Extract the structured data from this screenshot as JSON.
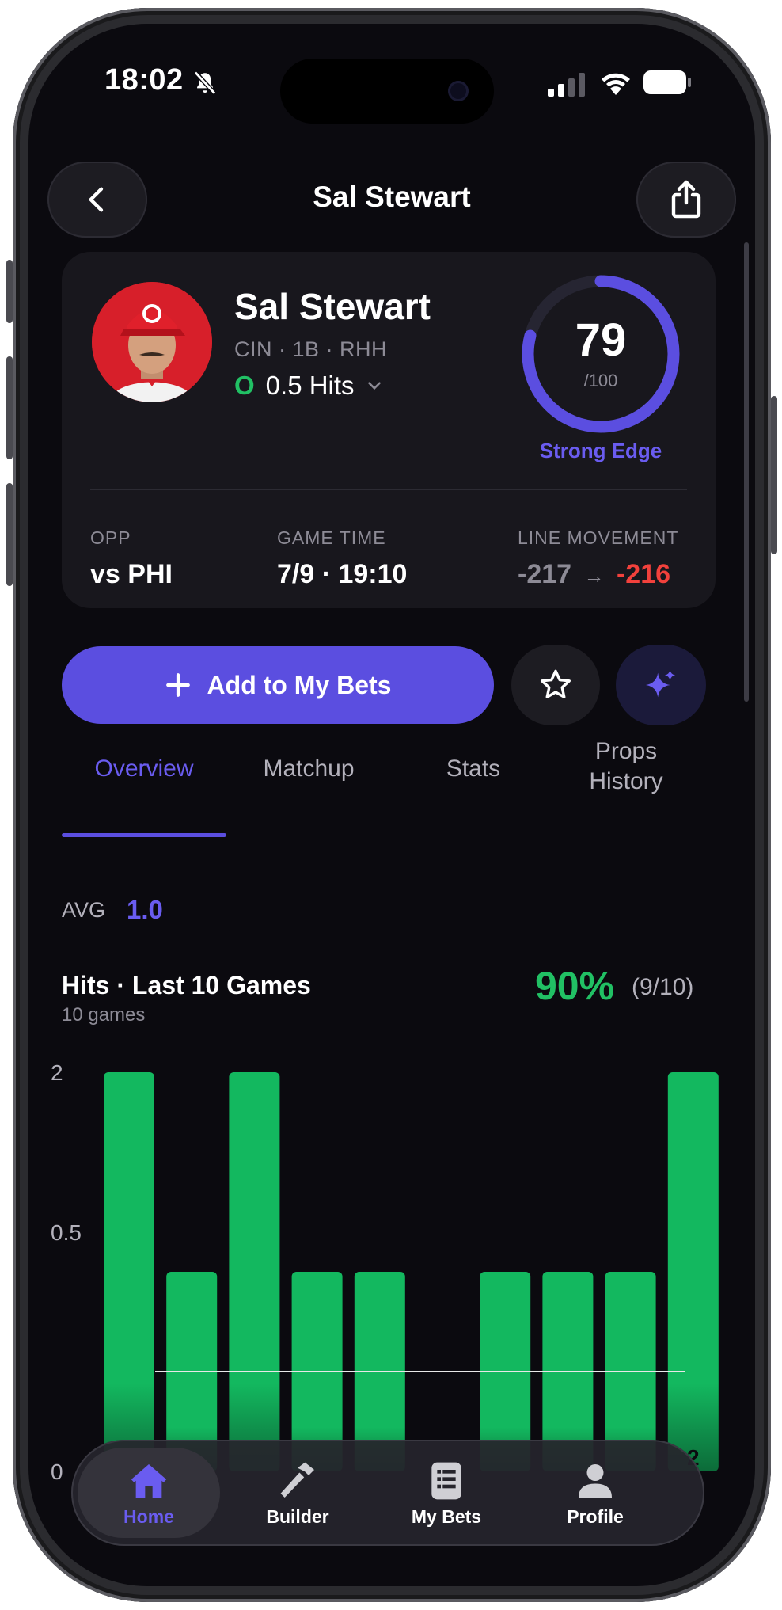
{
  "status": {
    "time": "18:02"
  },
  "nav": {
    "title": "Sal Stewart"
  },
  "player": {
    "name": "Sal Stewart",
    "meta": "CIN · 1B · RHH",
    "side": "O",
    "line": "0.5 Hits",
    "score": "79",
    "score_max": "/100",
    "score_fraction": 0.79,
    "edge_label": "Strong Edge"
  },
  "info": {
    "opp_label": "OPP",
    "opp_value": "vs PHI",
    "time_label": "GAME TIME",
    "time_value": "7/9 · 19:10",
    "move_label": "LINE MOVEMENT",
    "move_from": "-217",
    "move_arrow": "→",
    "move_to": "-216"
  },
  "actions": {
    "add_label": "Add to My Bets"
  },
  "tabs": [
    {
      "label": "Overview",
      "active": true
    },
    {
      "label": "Matchup",
      "active": false
    },
    {
      "label": "Stats",
      "active": false
    },
    {
      "label": "Props History",
      "active": false
    }
  ],
  "avg": {
    "label": "AVG",
    "value": "1.0"
  },
  "hits": {
    "title": "Hits · Last 10 Games",
    "subtitle": "10 games",
    "pct": "90%",
    "fraction": "(9/10)"
  },
  "chart_data": {
    "type": "bar",
    "title": "Hits · Last 10 Games",
    "y_tick_labels": [
      "2",
      "0.5",
      "0"
    ],
    "threshold": 0.5,
    "values": [
      2,
      1,
      2,
      1,
      1,
      0,
      1,
      1,
      1,
      2
    ],
    "visible_value_label": "2",
    "colors": {
      "bar": "#13b85f",
      "threshold": "#e8e8e8"
    }
  },
  "tabbar": [
    {
      "label": "Home",
      "icon": "home-icon",
      "active": true
    },
    {
      "label": "Builder",
      "icon": "hammer-icon",
      "active": false
    },
    {
      "label": "My Bets",
      "icon": "list-icon",
      "active": false
    },
    {
      "label": "Profile",
      "icon": "person-icon",
      "active": false
    }
  ],
  "colors": {
    "accent": "#5b4ee0",
    "positive": "#21c064",
    "negative": "#f2413c",
    "background": "#0b0a0f"
  }
}
